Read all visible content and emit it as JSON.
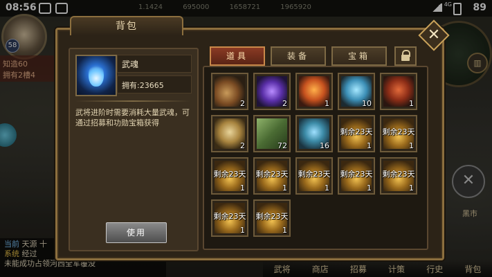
{
  "status_bar": {
    "time": "08:56",
    "battery": "89",
    "network": "4G"
  },
  "hud": {
    "stats": [
      "1.1424",
      "695000",
      "1658721",
      "1965920"
    ],
    "player_level": "58",
    "left_info_1": "知造60",
    "left_info_2": "拥有2槽4"
  },
  "bag": {
    "title": "背包",
    "selected_item": {
      "name": "武魂",
      "owned": "拥有:23665",
      "description": "武将进阶时需要消耗大量武魂，可通过招募和功勋宝箱获得"
    },
    "use_button": "使用",
    "tabs": [
      {
        "label": "道具",
        "active": true
      },
      {
        "label": "装备",
        "active": false
      },
      {
        "label": "宝箱",
        "active": false
      }
    ],
    "items": [
      {
        "icon": "horn-icon",
        "art": "horn",
        "qty": "2"
      },
      {
        "icon": "crystal-icon",
        "art": "crystal",
        "qty": "2"
      },
      {
        "icon": "fire-token-icon",
        "art": "fire",
        "qty": "1"
      },
      {
        "icon": "ice-token-icon",
        "art": "ice",
        "qty": "10"
      },
      {
        "icon": "bag-icon",
        "art": "bag",
        "qty": "1"
      },
      {
        "icon": "scroll-icon",
        "art": "scroll",
        "qty": "2"
      },
      {
        "icon": "book-icon",
        "art": "book",
        "qty": "72"
      },
      {
        "icon": "card-icon",
        "art": "card",
        "qty": "16"
      },
      {
        "icon": "chest-icon",
        "art": "chest",
        "days": "剩余23天",
        "qty": "1"
      },
      {
        "icon": "chest-icon",
        "art": "chest",
        "days": "剩余23天",
        "qty": "1"
      },
      {
        "icon": "chest-icon",
        "art": "chest",
        "days": "剩余23天",
        "qty": "1"
      },
      {
        "icon": "chest-icon",
        "art": "chest",
        "days": "剩余23天",
        "qty": "1"
      },
      {
        "icon": "chest-icon",
        "art": "chest",
        "days": "剩余23天",
        "qty": "1"
      },
      {
        "icon": "chest-icon",
        "art": "chest",
        "days": "剩余23天",
        "qty": "1"
      },
      {
        "icon": "chest-icon",
        "art": "chest",
        "days": "剩余23天",
        "qty": "1"
      },
      {
        "icon": "chest-icon",
        "art": "chest",
        "days": "剩余23天",
        "qty": "1"
      },
      {
        "icon": "chest-icon",
        "art": "chest",
        "days": "剩余23天",
        "qty": "1"
      }
    ]
  },
  "chat": [
    {
      "tag": "当前",
      "text": "天源 十"
    },
    {
      "tag": "系统",
      "text": "经过"
    },
    {
      "tag": "",
      "text": "未能成功占领河西全军覆没"
    }
  ],
  "right_side": {
    "black_market": "黑市"
  },
  "bottom_nav": [
    "武将",
    "商店",
    "招募",
    "计策",
    "行史",
    "背包"
  ],
  "colors": {
    "frame": "#8c6f3e",
    "active_tab": "#8a3a24",
    "panel": "#2c2317"
  }
}
